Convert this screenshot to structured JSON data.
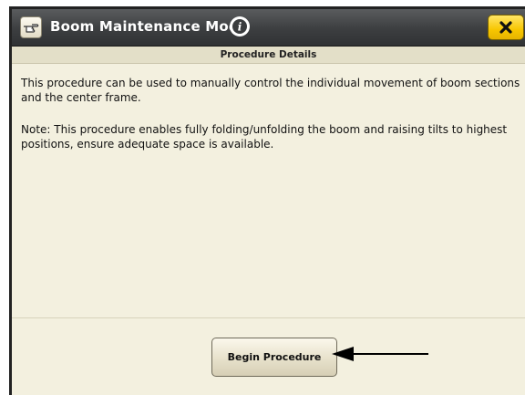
{
  "dialog": {
    "title": "Boom Maintenance Mode",
    "section_header": "Procedure Details",
    "paragraphs": [
      "This procedure can be used to manually control the individual movement of boom sections and the center frame.",
      "Note: This procedure enables fully folding/unfolding the boom and raising tilts to highest positions, ensure adequate space is available."
    ],
    "begin_button_label": "Begin Procedure",
    "close_button_glyph": "✕",
    "info_glyph": "i"
  },
  "icons": {
    "title": "pointing-hand-icon",
    "info": "info-icon",
    "close": "close-icon",
    "callout": "arrow-left-icon"
  },
  "colors": {
    "titlebar": "#3c3e40",
    "panel": "#f3f0df",
    "close_button": "#f7c600"
  }
}
